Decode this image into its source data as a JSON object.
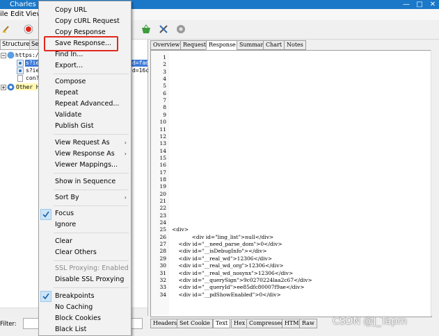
{
  "window": {
    "title": "Charles 4"
  },
  "menubar": [
    "ile",
    "Edit",
    "View"
  ],
  "left_panel": {
    "tabs": [
      "Structure",
      "Se"
    ],
    "tree": [
      "https:/",
      "s?ie",
      "s?ie",
      "con?",
      "Other H"
    ],
    "tree_right": [
      "d=fad",
      "d=16c"
    ],
    "filter_label": "Filter:"
  },
  "context_menu": {
    "items": [
      {
        "label": "Copy URL"
      },
      {
        "label": "Copy cURL Request"
      },
      {
        "label": "Copy Response"
      },
      {
        "label": "Save Response..."
      },
      {
        "label": "Find In..."
      },
      {
        "label": "Export..."
      },
      {
        "label": "Compose"
      },
      {
        "label": "Repeat"
      },
      {
        "label": "Repeat Advanced..."
      },
      {
        "label": "Validate"
      },
      {
        "label": "Publish Gist"
      },
      {
        "label": "View Request As"
      },
      {
        "label": "View Response As"
      },
      {
        "label": "Viewer Mappings..."
      },
      {
        "label": "Show in Sequence"
      },
      {
        "label": "Sort By"
      },
      {
        "label": "Focus"
      },
      {
        "label": "Ignore"
      },
      {
        "label": "Clear"
      },
      {
        "label": "Clear Others"
      },
      {
        "label": "SSL Proxying: Enabled"
      },
      {
        "label": "Disable SSL Proxying"
      },
      {
        "label": "Breakpoints"
      },
      {
        "label": "No Caching"
      },
      {
        "label": "Block Cookies"
      },
      {
        "label": "Black List"
      }
    ]
  },
  "right_tabs": [
    "Overview",
    "Request",
    "Response",
    "Summary",
    "Chart",
    "Notes"
  ],
  "bottom_tabs": [
    "Headers",
    "Set Cookie",
    "Text",
    "Hex",
    "Compressed",
    "HTML",
    "Raw"
  ],
  "editor": {
    "line_numbers": [
      "1",
      "2",
      "3",
      "4",
      "5",
      "6",
      "7",
      "8",
      "9",
      "10",
      "11",
      "12",
      "13",
      "14",
      "15",
      "16",
      "17",
      "18",
      "19",
      "20",
      "21",
      "22",
      "23",
      "24",
      "25",
      "26",
      "27",
      "28",
      "29",
      "30",
      "31",
      "32",
      "33",
      "34"
    ],
    "code_lines": {
      "25": "<div>",
      "26": "            <div id=\"ling_list\">null</div>",
      "27": "    <div id=\"__need_parse_dom\">0</div>",
      "28": "    <div id=\"__isDebugInfo\"></div>",
      "29": "    <div id=\"__real_wd\">12306</div>",
      "30": "    <div id=\"__real_wd_org\">12306</div>",
      "31": "    <div id=\"__real_wd_nosynx\">12306</div>",
      "32": "    <div id=\"__querySign\">9c0270224laa2c67</div>",
      "33": "    <div id=\"__queryId\">ee85dfc80007f9ae</div>",
      "34": "    <div id=\"__pdShowEnabled\">0</div>"
    }
  },
  "watermark": "CSDN @J_Tapm",
  "colors": {
    "title_bar": "#1b78c8",
    "highlight": "#e0281e",
    "selection": "#cce4f7"
  }
}
